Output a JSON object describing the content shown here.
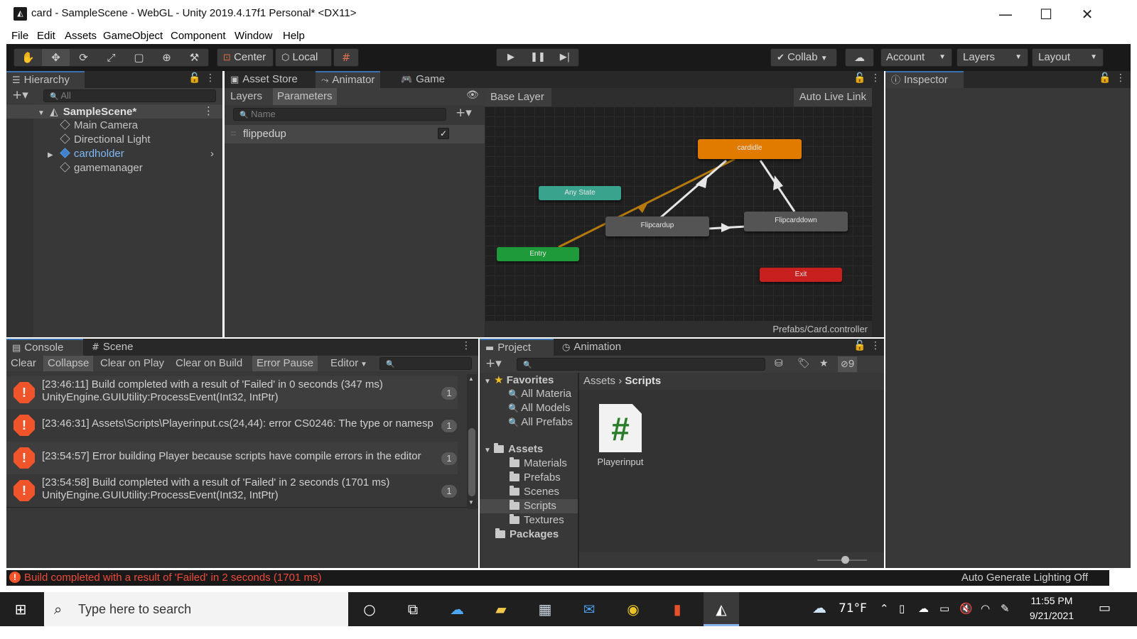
{
  "window": {
    "title": "card - SampleScene - WebGL - Unity 2019.4.17f1 Personal* <DX11>",
    "minimize_glyph": "—",
    "maximize_glyph": "☐",
    "close_glyph": "✕"
  },
  "menu": [
    "File",
    "Edit",
    "Assets",
    "GameObject",
    "Component",
    "Window",
    "Help"
  ],
  "toolbar": {
    "tools": [
      "hand-tool-icon",
      "move-tool-icon",
      "rotate-tool-icon",
      "scale-tool-icon",
      "rect-tool-icon",
      "transform-tool-icon",
      "custom-tool-icon"
    ],
    "pivot_label": "Center",
    "space_label": "Local",
    "collab_label": "Collab",
    "account_label": "Account",
    "layers_label": "Layers",
    "layout_label": "Layout"
  },
  "hierarchy": {
    "tab_label": "Hierarchy",
    "search_placeholder": "All",
    "scene_name": "SampleScene*",
    "items": [
      {
        "label": "Main Camera"
      },
      {
        "label": "Directional Light"
      },
      {
        "label": "cardholder"
      },
      {
        "label": "gamemanager"
      }
    ]
  },
  "center_tabs": {
    "asset_store": "Asset Store",
    "animator": "Animator",
    "game": "Game"
  },
  "animator": {
    "layers_tab": "Layers",
    "parameters_tab": "Parameters",
    "name_placeholder": "Name",
    "parameters": [
      {
        "name": "flippedup",
        "checked": true
      }
    ],
    "breadcrumb": "Base Layer",
    "auto_live_link": "Auto Live Link",
    "controller_path": "Prefabs/Card.controller",
    "states": {
      "cardidle": "cardidle",
      "any_state": "Any State",
      "flipcardup": "Flipcardup",
      "flipcarddown": "Flipcarddown",
      "entry": "Entry",
      "exit": "Exit"
    },
    "colors": {
      "default_state": "#e07b00",
      "any_state": "#3aa38e",
      "entry": "#1e9a3a",
      "exit": "#c81f1f",
      "state": "#545454"
    }
  },
  "inspector": {
    "tab_label": "Inspector"
  },
  "console": {
    "tab_label": "Console",
    "scene_tab": "Scene",
    "buttons": {
      "clear": "Clear",
      "collapse": "Collapse",
      "clear_on_play": "Clear on Play",
      "clear_on_build": "Clear on Build",
      "error_pause": "Error Pause",
      "editor": "Editor"
    },
    "logs": [
      {
        "line1": "[23:46:11] Build completed with a result of 'Failed' in 0 seconds (347 ms)",
        "line2": "UnityEngine.GUIUtility:ProcessEvent(Int32, IntPtr)",
        "count": "1"
      },
      {
        "line1": "[23:46:31] Assets\\Scripts\\Playerinput.cs(24,44): error CS0246: The type or namesp",
        "line2": "",
        "count": "1"
      },
      {
        "line1": "[23:54:57] Error building Player because scripts have compile errors in the editor",
        "line2": "",
        "count": "1"
      },
      {
        "line1": "[23:54:58] Build completed with a result of 'Failed' in 2 seconds (1701 ms)",
        "line2": "UnityEngine.GUIUtility:ProcessEvent(Int32, IntPtr)",
        "count": "1"
      }
    ]
  },
  "project": {
    "tab_label": "Project",
    "animation_tab": "Animation",
    "hidden_count": "9",
    "favorites_label": "Favorites",
    "favorites": [
      "All Materia",
      "All Models",
      "All Prefabs"
    ],
    "assets_label": "Assets",
    "asset_folders": [
      "Materials",
      "Prefabs",
      "Scenes",
      "Scripts",
      "Textures"
    ],
    "packages_label": "Packages",
    "breadcrumb_root": "Assets",
    "breadcrumb_current": "Scripts",
    "files": [
      {
        "name": "Playerinput",
        "icon": "#"
      }
    ],
    "zoom_fraction": 0.55
  },
  "status": {
    "message": "Build completed with a result of 'Failed' in 2 seconds (1701 ms)",
    "lighting": "Auto Generate Lighting Off"
  },
  "taskbar": {
    "search_placeholder": "Type here to search",
    "temperature": "71°F",
    "time": "11:55 PM",
    "date": "9/21/2021"
  }
}
